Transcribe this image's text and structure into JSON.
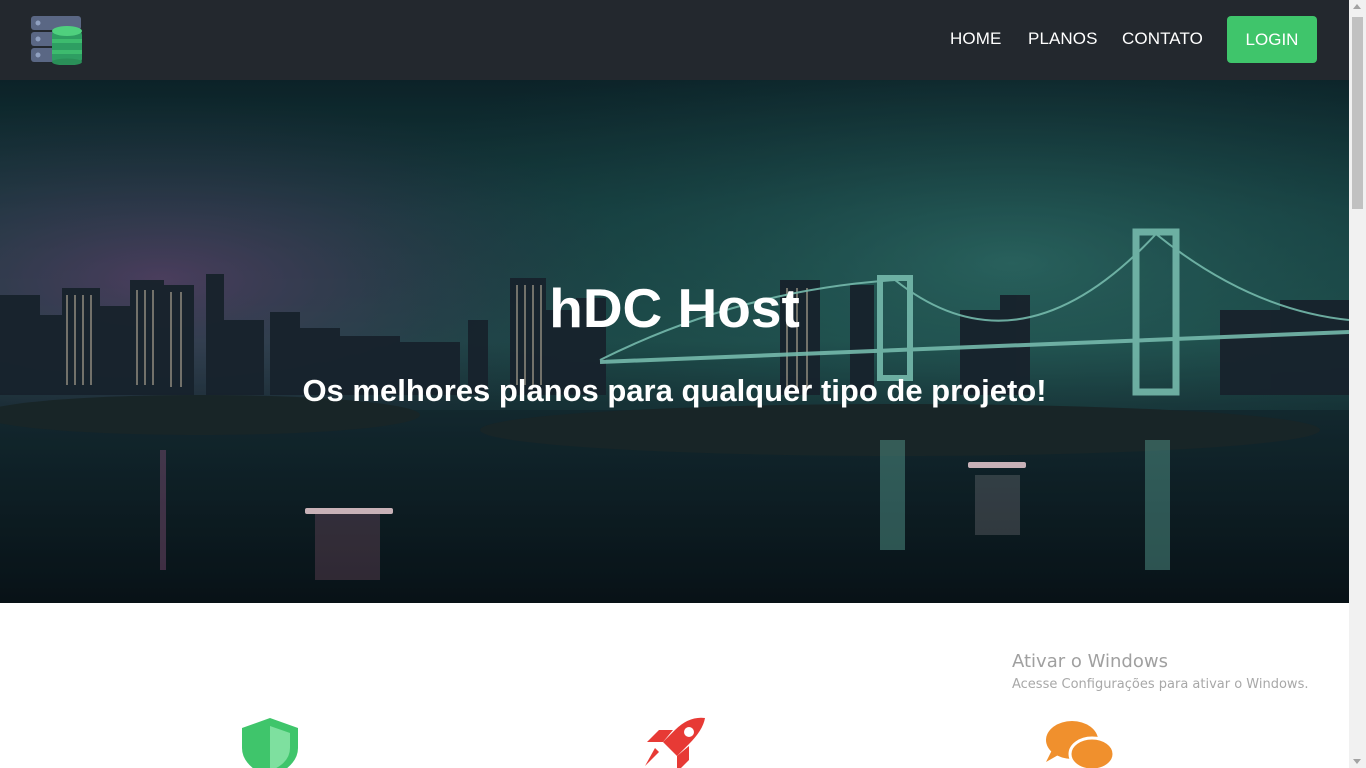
{
  "navbar": {
    "logo_icon": "database-server-icon",
    "links": [
      {
        "label": "HOME"
      },
      {
        "label": "PLANOS"
      },
      {
        "label": "CONTATO"
      }
    ],
    "login_label": "LOGIN"
  },
  "hero": {
    "title": "hDC Host",
    "subtitle": "Os melhores planos para qualquer tipo de projeto!"
  },
  "features": [
    {
      "icon": "shield-icon",
      "color": "#3fc56b"
    },
    {
      "icon": "rocket-icon",
      "color": "#e73a35"
    },
    {
      "icon": "chat-bubbles-icon",
      "color": "#f0902d"
    }
  ],
  "watermark": {
    "title": "Ativar o Windows",
    "subtitle": "Acesse Configurações para ativar o Windows."
  },
  "colors": {
    "navbar_bg": "#23282e",
    "accent_green": "#3fc56b"
  }
}
